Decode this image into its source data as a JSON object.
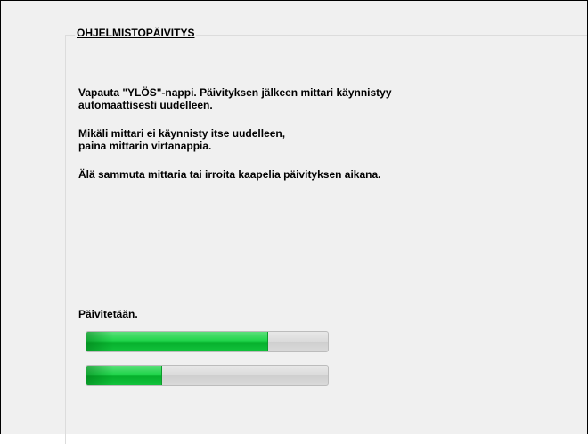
{
  "group": {
    "title": "OHJELMISTOPÄIVITYS"
  },
  "messages": {
    "line1": "Vapauta \"YLÖS\"-nappi. Päivityksen jälkeen mittari käynnistyy",
    "line2": "automaattisesti uudelleen.",
    "line3": "Mikäli mittari ei käynnisty itse uudelleen,",
    "line4": "paina mittarin virtanappia.",
    "line5": "Älä sammuta mittaria tai irroita kaapelia päivityksen aikana."
  },
  "status": {
    "label": "Päivitetään."
  },
  "progress": [
    {
      "name": "progress-bar-overall",
      "fraction": 0.75
    },
    {
      "name": "progress-bar-current",
      "fraction": 0.31
    }
  ],
  "colors": {
    "progress_fill": "#06b02c",
    "background": "#f0f0f0"
  }
}
